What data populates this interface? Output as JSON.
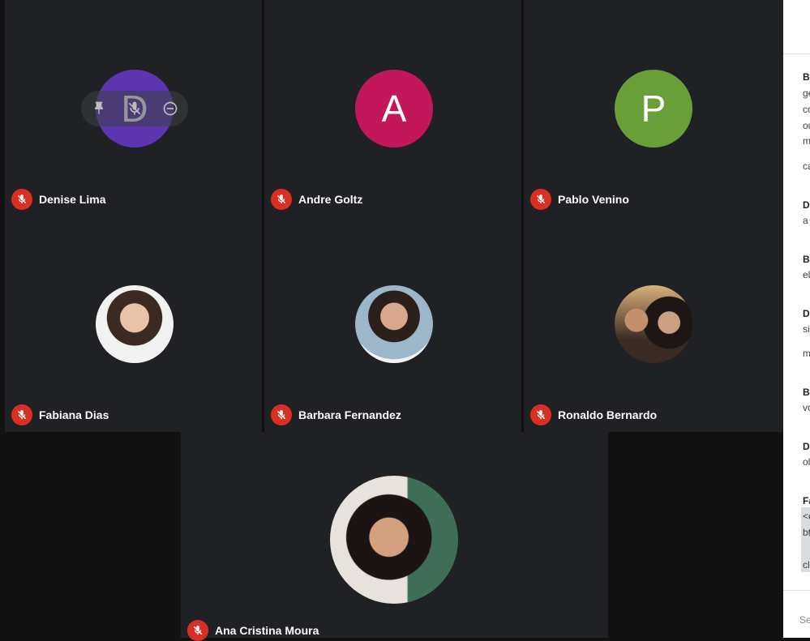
{
  "colors": {
    "tile_bg": "#202124",
    "muted_mic": "#d93025",
    "avatar_denise": "#5e35b1",
    "avatar_andre": "#c2185b",
    "avatar_pablo": "#689f38"
  },
  "participants": [
    {
      "name": "Denise Lima",
      "initial": "D",
      "mic": "muted"
    },
    {
      "name": "Andre Goltz",
      "initial": "A",
      "mic": "muted"
    },
    {
      "name": "Pablo Venino",
      "initial": "P",
      "mic": "muted"
    },
    {
      "name": "Fabiana Dias",
      "mic": "muted"
    },
    {
      "name": "Barbara Fernandez",
      "mic": "muted"
    },
    {
      "name": "Ronaldo Bernardo",
      "mic": "muted"
    },
    {
      "name": "Ana Cristina Moura",
      "mic": "muted"
    }
  ],
  "hover_controls": {
    "icons": [
      "pin-icon",
      "mic-off-icon",
      "remove-icon"
    ]
  },
  "chat": {
    "fragments": [
      "B",
      "ge",
      "co",
      "ou",
      "m",
      "ca",
      "D",
      "a",
      "B",
      "el",
      "D",
      "si",
      "m",
      "B",
      "vo",
      "D",
      "ol",
      "Fa",
      "<c",
      "bt",
      "cl"
    ],
    "input_placeholder": "Se"
  }
}
